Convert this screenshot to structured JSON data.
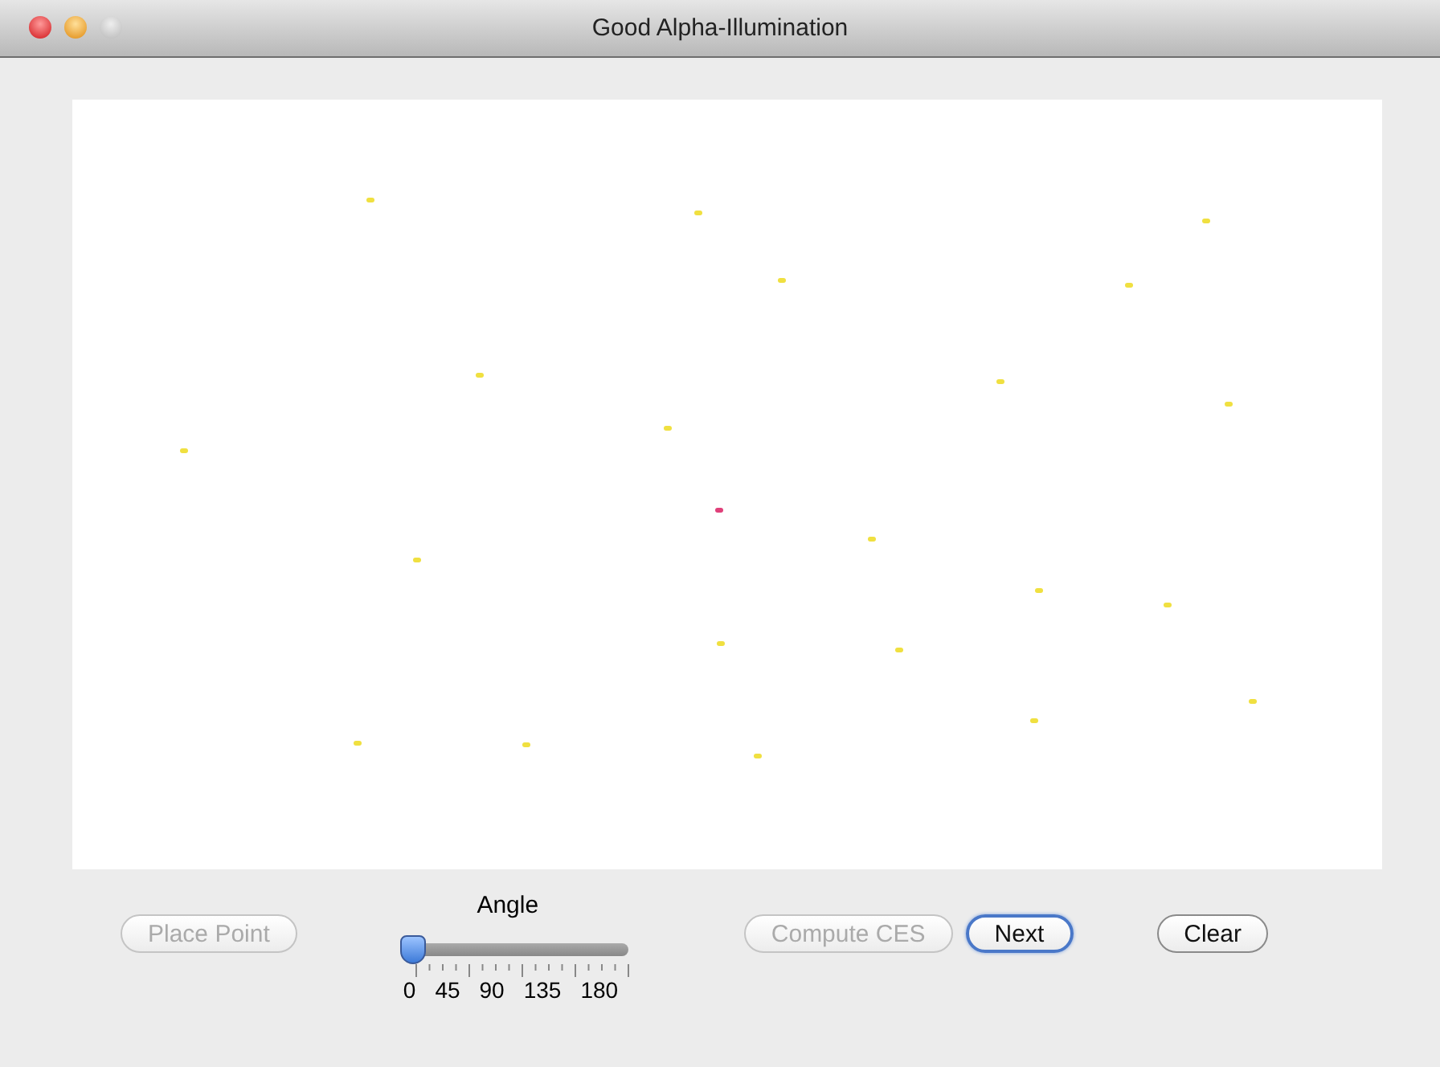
{
  "window": {
    "title": "Good Alpha-Illumination",
    "buttons": [
      {
        "kind": "close"
      },
      {
        "kind": "minimize"
      },
      {
        "kind": "zoom"
      }
    ]
  },
  "points": [
    {
      "color": "#f0e040"
    },
    {
      "color": "#f0e040"
    },
    {
      "color": "#f0e040"
    },
    {
      "color": "#f0e040"
    },
    {
      "color": "#f0e040"
    },
    {
      "color": "#f0e040"
    },
    {
      "color": "#f0e040"
    },
    {
      "color": "#f0e040"
    },
    {
      "color": "#f0e040"
    },
    {
      "color": "#f0e040"
    },
    {
      "color": "#e0407a"
    },
    {
      "color": "#f0e040"
    },
    {
      "color": "#f0e040"
    },
    {
      "color": "#f0e040"
    },
    {
      "color": "#f0e040"
    },
    {
      "color": "#f0e040"
    },
    {
      "color": "#f0e040"
    },
    {
      "color": "#f0e040"
    },
    {
      "color": "#f0e040"
    },
    {
      "color": "#f0e040"
    },
    {
      "color": "#f0e040"
    },
    {
      "color": "#f0e040"
    }
  ],
  "controls": {
    "place_point": {
      "label": "Place Point",
      "disabled": true
    },
    "angle": {
      "label": "Angle",
      "level": 0,
      "tick_labels": [
        "0",
        "45",
        "90",
        "135",
        "180"
      ]
    },
    "compute": {
      "label": "Compute CES",
      "disabled": true
    },
    "next": {
      "label": "Next",
      "disabled": false,
      "default": true
    },
    "clear": {
      "label": "Clear",
      "disabled": false
    }
  }
}
